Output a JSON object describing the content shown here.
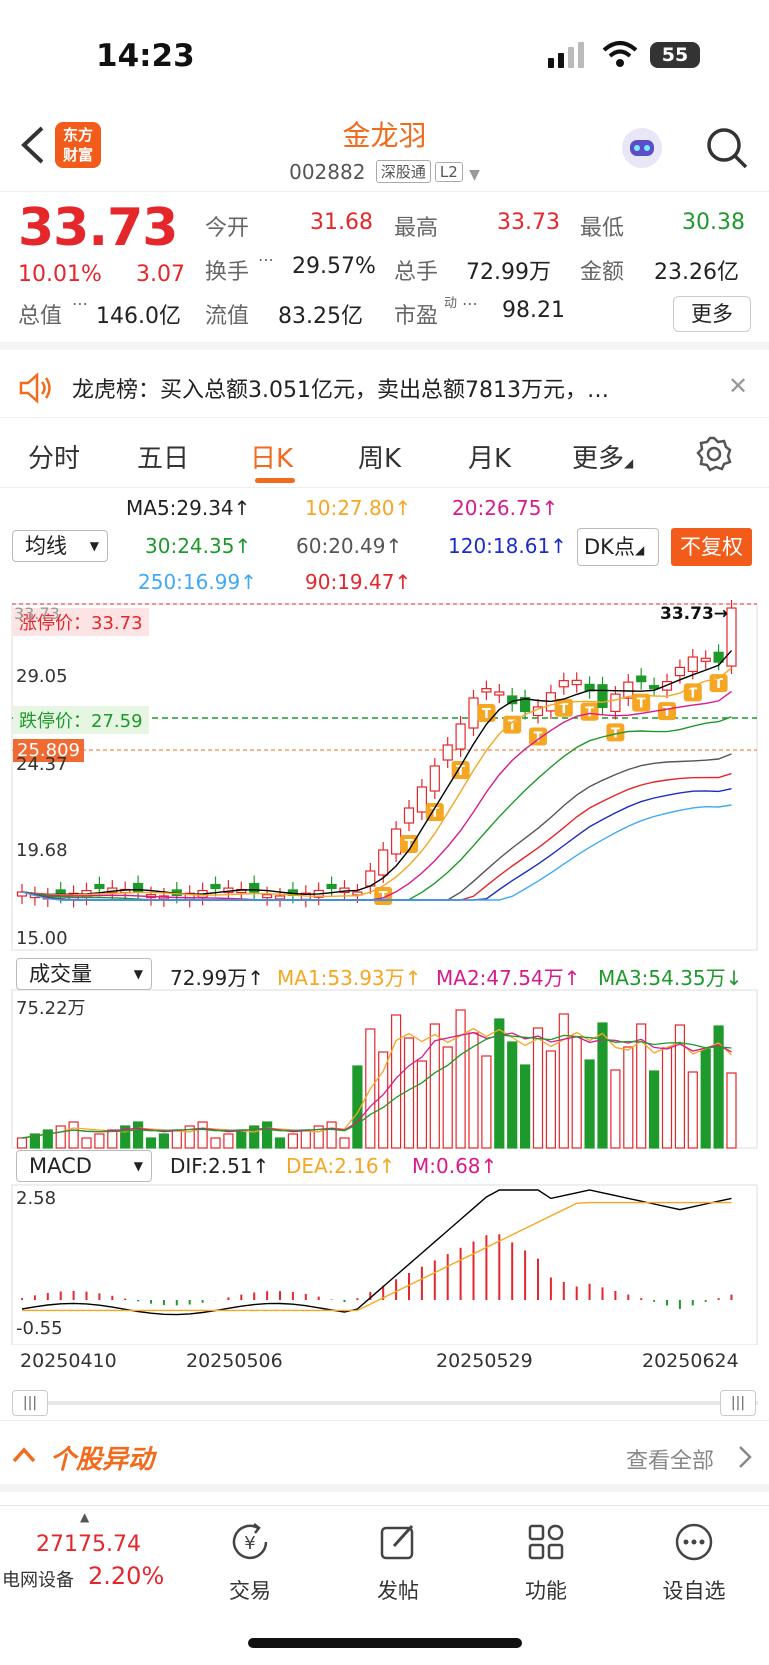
{
  "status": {
    "time": "14:23",
    "battery": "55"
  },
  "nav": {
    "logo": "东方\n财富",
    "name": "金龙羽",
    "code": "002882",
    "tag1": "深股通",
    "tag2": "L2"
  },
  "quote": {
    "price": "33.73",
    "pct": "10.01%",
    "chg": "3.07",
    "open_label": "今开",
    "open": "31.68",
    "high_label": "最高",
    "high": "33.73",
    "low_label": "最低",
    "low": "30.38",
    "turnover_label": "换手",
    "turnover": "29.57%",
    "volume_label": "总手",
    "volume": "72.99万",
    "amount_label": "金额",
    "amount": "23.26亿",
    "mcap_label": "总值",
    "mcap": "146.0亿",
    "float_label": "流值",
    "float": "83.25亿",
    "pe_label": "市盈",
    "pe_sup": "动",
    "pe": "98.21",
    "more_label": "更多"
  },
  "notice": {
    "text": "龙虎榜：买入总额3.051亿元，卖出总额7813万元，…"
  },
  "tabs": [
    "分时",
    "五日",
    "日K",
    "周K",
    "月K",
    "更多"
  ],
  "ma": {
    "selector": "均线",
    "ma5": "MA5:29.34↑",
    "ma10": "10:27.80↑",
    "ma20": "20:26.75↑",
    "ma30": "30:24.35↑",
    "ma60": "60:20.49↑",
    "ma120": "120:18.61↑",
    "ma250": "250:16.99↑",
    "ma90": "90:19.47↑",
    "dk": "DK点",
    "fq": "不复权"
  },
  "kline": {
    "top_label": "33.73→",
    "limit_up": "涨停价：33.73",
    "limit_down": "跌停价：27.59",
    "cursor_price": "25.809",
    "p1": "29.05",
    "p2": "24.37",
    "p3": "19.68",
    "p4": "15.00",
    "p_top": "33.73"
  },
  "volume": {
    "selector": "成交量",
    "vol": "72.99万↑",
    "ma1": "MA1:53.93万↑",
    "ma2": "MA2:47.54万↑",
    "ma3": "MA3:54.35万↓",
    "max": "75.22万"
  },
  "macd": {
    "selector": "MACD",
    "dif": "DIF:2.51↑",
    "dea": "DEA:2.16↑",
    "m": "M:0.68↑",
    "max": "2.58",
    "min": "-0.55"
  },
  "dates": [
    "20250410",
    "20250506",
    "20250529",
    "20250624"
  ],
  "section": {
    "title": "个股异动",
    "more": "查看全部"
  },
  "bottom": {
    "index_value": "27175.74",
    "index_name": "电网设备",
    "index_pct": "2.20%",
    "items": [
      "交易",
      "发帖",
      "功能",
      "设自选"
    ]
  },
  "colors": {
    "up": "#e5262a",
    "down": "#1d9a2b",
    "accent": "#f26a1b",
    "ma5": "#000000",
    "ma10": "#f5a623",
    "ma20": "#d81b8c",
    "ma30": "#1d9a2b",
    "ma60": "#555555",
    "ma120": "#1a2dc4",
    "ma250": "#3fa9f5",
    "ma90": "#e5262a"
  }
}
